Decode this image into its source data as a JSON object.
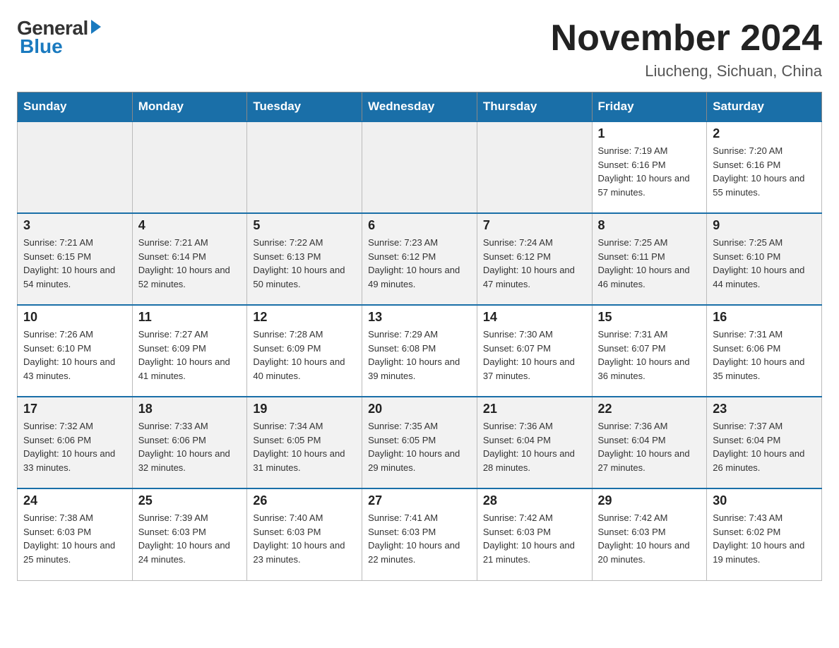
{
  "header": {
    "logo_general": "General",
    "logo_blue": "Blue",
    "month_title": "November 2024",
    "location": "Liucheng, Sichuan, China"
  },
  "days_of_week": [
    "Sunday",
    "Monday",
    "Tuesday",
    "Wednesday",
    "Thursday",
    "Friday",
    "Saturday"
  ],
  "weeks": [
    {
      "days": [
        {
          "num": "",
          "info": ""
        },
        {
          "num": "",
          "info": ""
        },
        {
          "num": "",
          "info": ""
        },
        {
          "num": "",
          "info": ""
        },
        {
          "num": "",
          "info": ""
        },
        {
          "num": "1",
          "info": "Sunrise: 7:19 AM\nSunset: 6:16 PM\nDaylight: 10 hours and 57 minutes."
        },
        {
          "num": "2",
          "info": "Sunrise: 7:20 AM\nSunset: 6:16 PM\nDaylight: 10 hours and 55 minutes."
        }
      ]
    },
    {
      "days": [
        {
          "num": "3",
          "info": "Sunrise: 7:21 AM\nSunset: 6:15 PM\nDaylight: 10 hours and 54 minutes."
        },
        {
          "num": "4",
          "info": "Sunrise: 7:21 AM\nSunset: 6:14 PM\nDaylight: 10 hours and 52 minutes."
        },
        {
          "num": "5",
          "info": "Sunrise: 7:22 AM\nSunset: 6:13 PM\nDaylight: 10 hours and 50 minutes."
        },
        {
          "num": "6",
          "info": "Sunrise: 7:23 AM\nSunset: 6:12 PM\nDaylight: 10 hours and 49 minutes."
        },
        {
          "num": "7",
          "info": "Sunrise: 7:24 AM\nSunset: 6:12 PM\nDaylight: 10 hours and 47 minutes."
        },
        {
          "num": "8",
          "info": "Sunrise: 7:25 AM\nSunset: 6:11 PM\nDaylight: 10 hours and 46 minutes."
        },
        {
          "num": "9",
          "info": "Sunrise: 7:25 AM\nSunset: 6:10 PM\nDaylight: 10 hours and 44 minutes."
        }
      ]
    },
    {
      "days": [
        {
          "num": "10",
          "info": "Sunrise: 7:26 AM\nSunset: 6:10 PM\nDaylight: 10 hours and 43 minutes."
        },
        {
          "num": "11",
          "info": "Sunrise: 7:27 AM\nSunset: 6:09 PM\nDaylight: 10 hours and 41 minutes."
        },
        {
          "num": "12",
          "info": "Sunrise: 7:28 AM\nSunset: 6:09 PM\nDaylight: 10 hours and 40 minutes."
        },
        {
          "num": "13",
          "info": "Sunrise: 7:29 AM\nSunset: 6:08 PM\nDaylight: 10 hours and 39 minutes."
        },
        {
          "num": "14",
          "info": "Sunrise: 7:30 AM\nSunset: 6:07 PM\nDaylight: 10 hours and 37 minutes."
        },
        {
          "num": "15",
          "info": "Sunrise: 7:31 AM\nSunset: 6:07 PM\nDaylight: 10 hours and 36 minutes."
        },
        {
          "num": "16",
          "info": "Sunrise: 7:31 AM\nSunset: 6:06 PM\nDaylight: 10 hours and 35 minutes."
        }
      ]
    },
    {
      "days": [
        {
          "num": "17",
          "info": "Sunrise: 7:32 AM\nSunset: 6:06 PM\nDaylight: 10 hours and 33 minutes."
        },
        {
          "num": "18",
          "info": "Sunrise: 7:33 AM\nSunset: 6:06 PM\nDaylight: 10 hours and 32 minutes."
        },
        {
          "num": "19",
          "info": "Sunrise: 7:34 AM\nSunset: 6:05 PM\nDaylight: 10 hours and 31 minutes."
        },
        {
          "num": "20",
          "info": "Sunrise: 7:35 AM\nSunset: 6:05 PM\nDaylight: 10 hours and 29 minutes."
        },
        {
          "num": "21",
          "info": "Sunrise: 7:36 AM\nSunset: 6:04 PM\nDaylight: 10 hours and 28 minutes."
        },
        {
          "num": "22",
          "info": "Sunrise: 7:36 AM\nSunset: 6:04 PM\nDaylight: 10 hours and 27 minutes."
        },
        {
          "num": "23",
          "info": "Sunrise: 7:37 AM\nSunset: 6:04 PM\nDaylight: 10 hours and 26 minutes."
        }
      ]
    },
    {
      "days": [
        {
          "num": "24",
          "info": "Sunrise: 7:38 AM\nSunset: 6:03 PM\nDaylight: 10 hours and 25 minutes."
        },
        {
          "num": "25",
          "info": "Sunrise: 7:39 AM\nSunset: 6:03 PM\nDaylight: 10 hours and 24 minutes."
        },
        {
          "num": "26",
          "info": "Sunrise: 7:40 AM\nSunset: 6:03 PM\nDaylight: 10 hours and 23 minutes."
        },
        {
          "num": "27",
          "info": "Sunrise: 7:41 AM\nSunset: 6:03 PM\nDaylight: 10 hours and 22 minutes."
        },
        {
          "num": "28",
          "info": "Sunrise: 7:42 AM\nSunset: 6:03 PM\nDaylight: 10 hours and 21 minutes."
        },
        {
          "num": "29",
          "info": "Sunrise: 7:42 AM\nSunset: 6:03 PM\nDaylight: 10 hours and 20 minutes."
        },
        {
          "num": "30",
          "info": "Sunrise: 7:43 AM\nSunset: 6:02 PM\nDaylight: 10 hours and 19 minutes."
        }
      ]
    }
  ]
}
